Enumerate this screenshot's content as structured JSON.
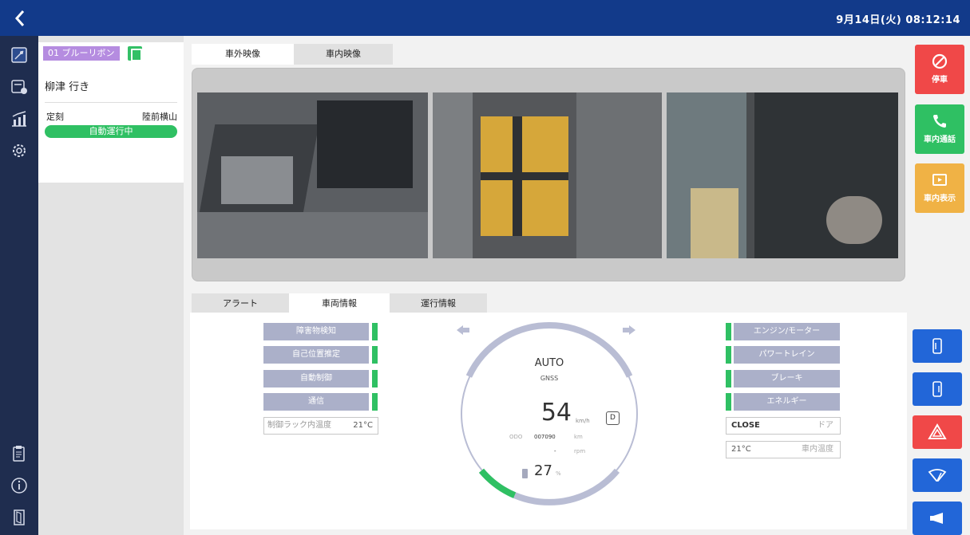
{
  "header": {
    "datetime": "9月14日(火) 08:12:14",
    "back_icon": "chevron-left-icon"
  },
  "sidebar": {
    "icons": [
      "map-icon",
      "bus-info-icon",
      "chart-icon",
      "gear-icon",
      "clipboard-icon",
      "info-icon",
      "door-icon"
    ]
  },
  "route": {
    "tag": "01 ブルーリボン",
    "destination": "柳津 行き",
    "schedule_label": "定刻",
    "next_stop": "陸前横山",
    "mode": "自動運行中"
  },
  "video": {
    "tabs": [
      "車外映像",
      "車内映像"
    ],
    "active_tab": 0
  },
  "info": {
    "tabs": [
      "アラート",
      "車両情報",
      "運行情報"
    ],
    "active_tab": 1,
    "left_status": [
      "障害物検知",
      "自己位置推定",
      "自動制御",
      "通信"
    ],
    "rack_temp_label": "制御ラック内温度",
    "rack_temp_value": "21°C",
    "right_status": [
      "エンジン/モーター",
      "パワートレイン",
      "ブレーキ",
      "エネルギー"
    ],
    "door_value": "CLOSE",
    "door_label": "ドア",
    "cabin_temp_value": "21°C",
    "cabin_temp_label": "車内温度"
  },
  "gauge": {
    "mode": "AUTO",
    "positioning": "GNSS",
    "speed": "54",
    "speed_unit": "km/h",
    "gear": "D",
    "odo_label": "ODO",
    "odo_value": "007090",
    "odo_unit": "km",
    "rpm_value": "-",
    "rpm_unit": "rpm",
    "battery": "27",
    "battery_unit": "%",
    "battery_level": 0.27
  },
  "actions": [
    {
      "label": "停車",
      "icon": "stop-icon",
      "color": "#f04848"
    },
    {
      "label": "車内通話",
      "icon": "phone-icon",
      "color": "#2fc063"
    },
    {
      "label": "車内表示",
      "icon": "display-icon",
      "color": "#f0b245"
    }
  ],
  "controls": [
    {
      "icon": "door-open-icon",
      "color": "#2266d8"
    },
    {
      "icon": "door-close-icon",
      "color": "#2266d8"
    },
    {
      "icon": "hazard-icon",
      "color": "#f04848"
    },
    {
      "icon": "wiper-icon",
      "color": "#2266d8"
    },
    {
      "icon": "horn-icon",
      "color": "#2266d8"
    }
  ]
}
